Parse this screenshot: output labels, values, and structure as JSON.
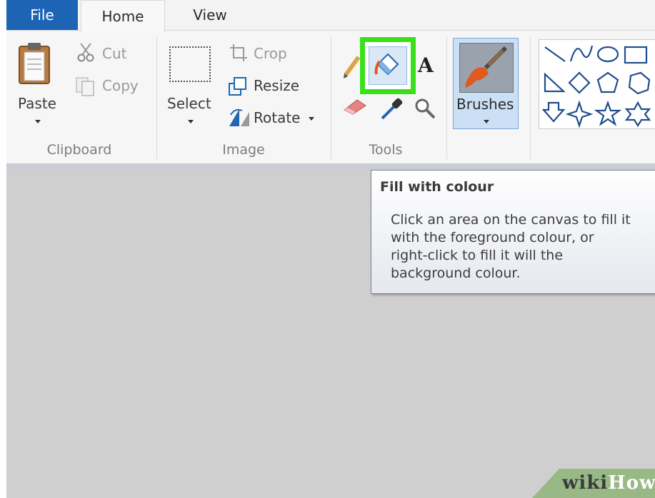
{
  "tabs": [
    {
      "label": "File"
    },
    {
      "label": "Home"
    },
    {
      "label": "View"
    }
  ],
  "clipboard": {
    "paste": "Paste",
    "cut": "Cut",
    "copy": "Copy",
    "group": "Clipboard"
  },
  "image": {
    "select": "Select",
    "crop": "Crop",
    "resize": "Resize",
    "rotate": "Rotate",
    "group": "Image"
  },
  "tools": {
    "group": "Tools",
    "text_glyph": "A",
    "icons": [
      "pencil-icon",
      "fill-bucket-icon",
      "text-icon",
      "eraser-icon",
      "color-picker-icon",
      "magnifier-icon"
    ],
    "highlight_color": "#39e11b"
  },
  "brushes": {
    "label": "Brushes"
  },
  "shapes": {
    "icons": [
      "line-icon",
      "curve-icon",
      "oval-icon",
      "rectangle-icon",
      "triangle-icon",
      "diamond-icon",
      "pentagon-icon",
      "hexagon-icon",
      "arrow-down-icon",
      "four-point-star-icon",
      "five-point-star-icon",
      "six-point-star-icon"
    ]
  },
  "tooltip": {
    "title": "Fill with colour",
    "lines": [
      "Click an area on the canvas to fill it",
      "with the foreground colour, or",
      "right-click to fill it will the",
      "background colour."
    ]
  },
  "watermark": {
    "wiki": "wiki",
    "how": "How"
  },
  "colors": {
    "file_tab": "#1d64b5",
    "ribbon": "#f6f6f6",
    "canvas": "#cfcfcf",
    "accent_blue": "#2067b0"
  }
}
